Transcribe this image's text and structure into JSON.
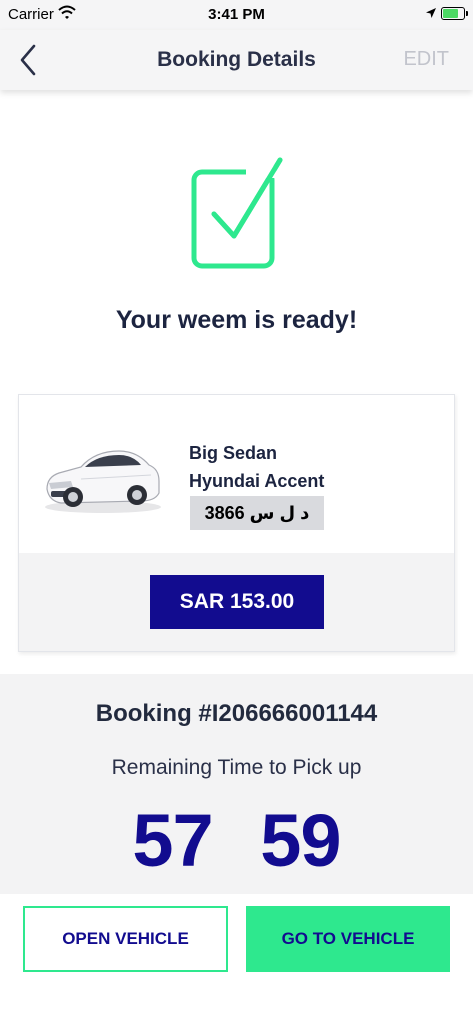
{
  "status_bar": {
    "carrier": "Carrier",
    "time": "3:41 PM",
    "icons": [
      "wifi-icon",
      "location-arrow-icon",
      "battery-charging-icon"
    ]
  },
  "nav": {
    "title": "Booking Details",
    "edit_label": "EDIT",
    "back_icon": "chevron-left-icon"
  },
  "confirmation": {
    "icon": "checkbox-checked-icon",
    "message": "Your weem is ready!"
  },
  "vehicle": {
    "class": "Big Sedan",
    "model": "Hyundai Accent",
    "plate": "د ل س 3866",
    "image": "white-sedan-car",
    "price": "SAR 153.00"
  },
  "booking": {
    "number_label": "Booking #I206666001144",
    "remaining_label": "Remaining Time to Pick up",
    "timer_minutes": "57",
    "timer_seconds": "59"
  },
  "actions": {
    "open_vehicle": "OPEN VEHICLE",
    "go_to_vehicle": "GO TO VEHICLE"
  },
  "colors": {
    "brand_navy": "#120c8f",
    "accent_green": "#2ee88e",
    "text_dark": "#1c2440",
    "edit_gray": "#c2c4cc"
  }
}
